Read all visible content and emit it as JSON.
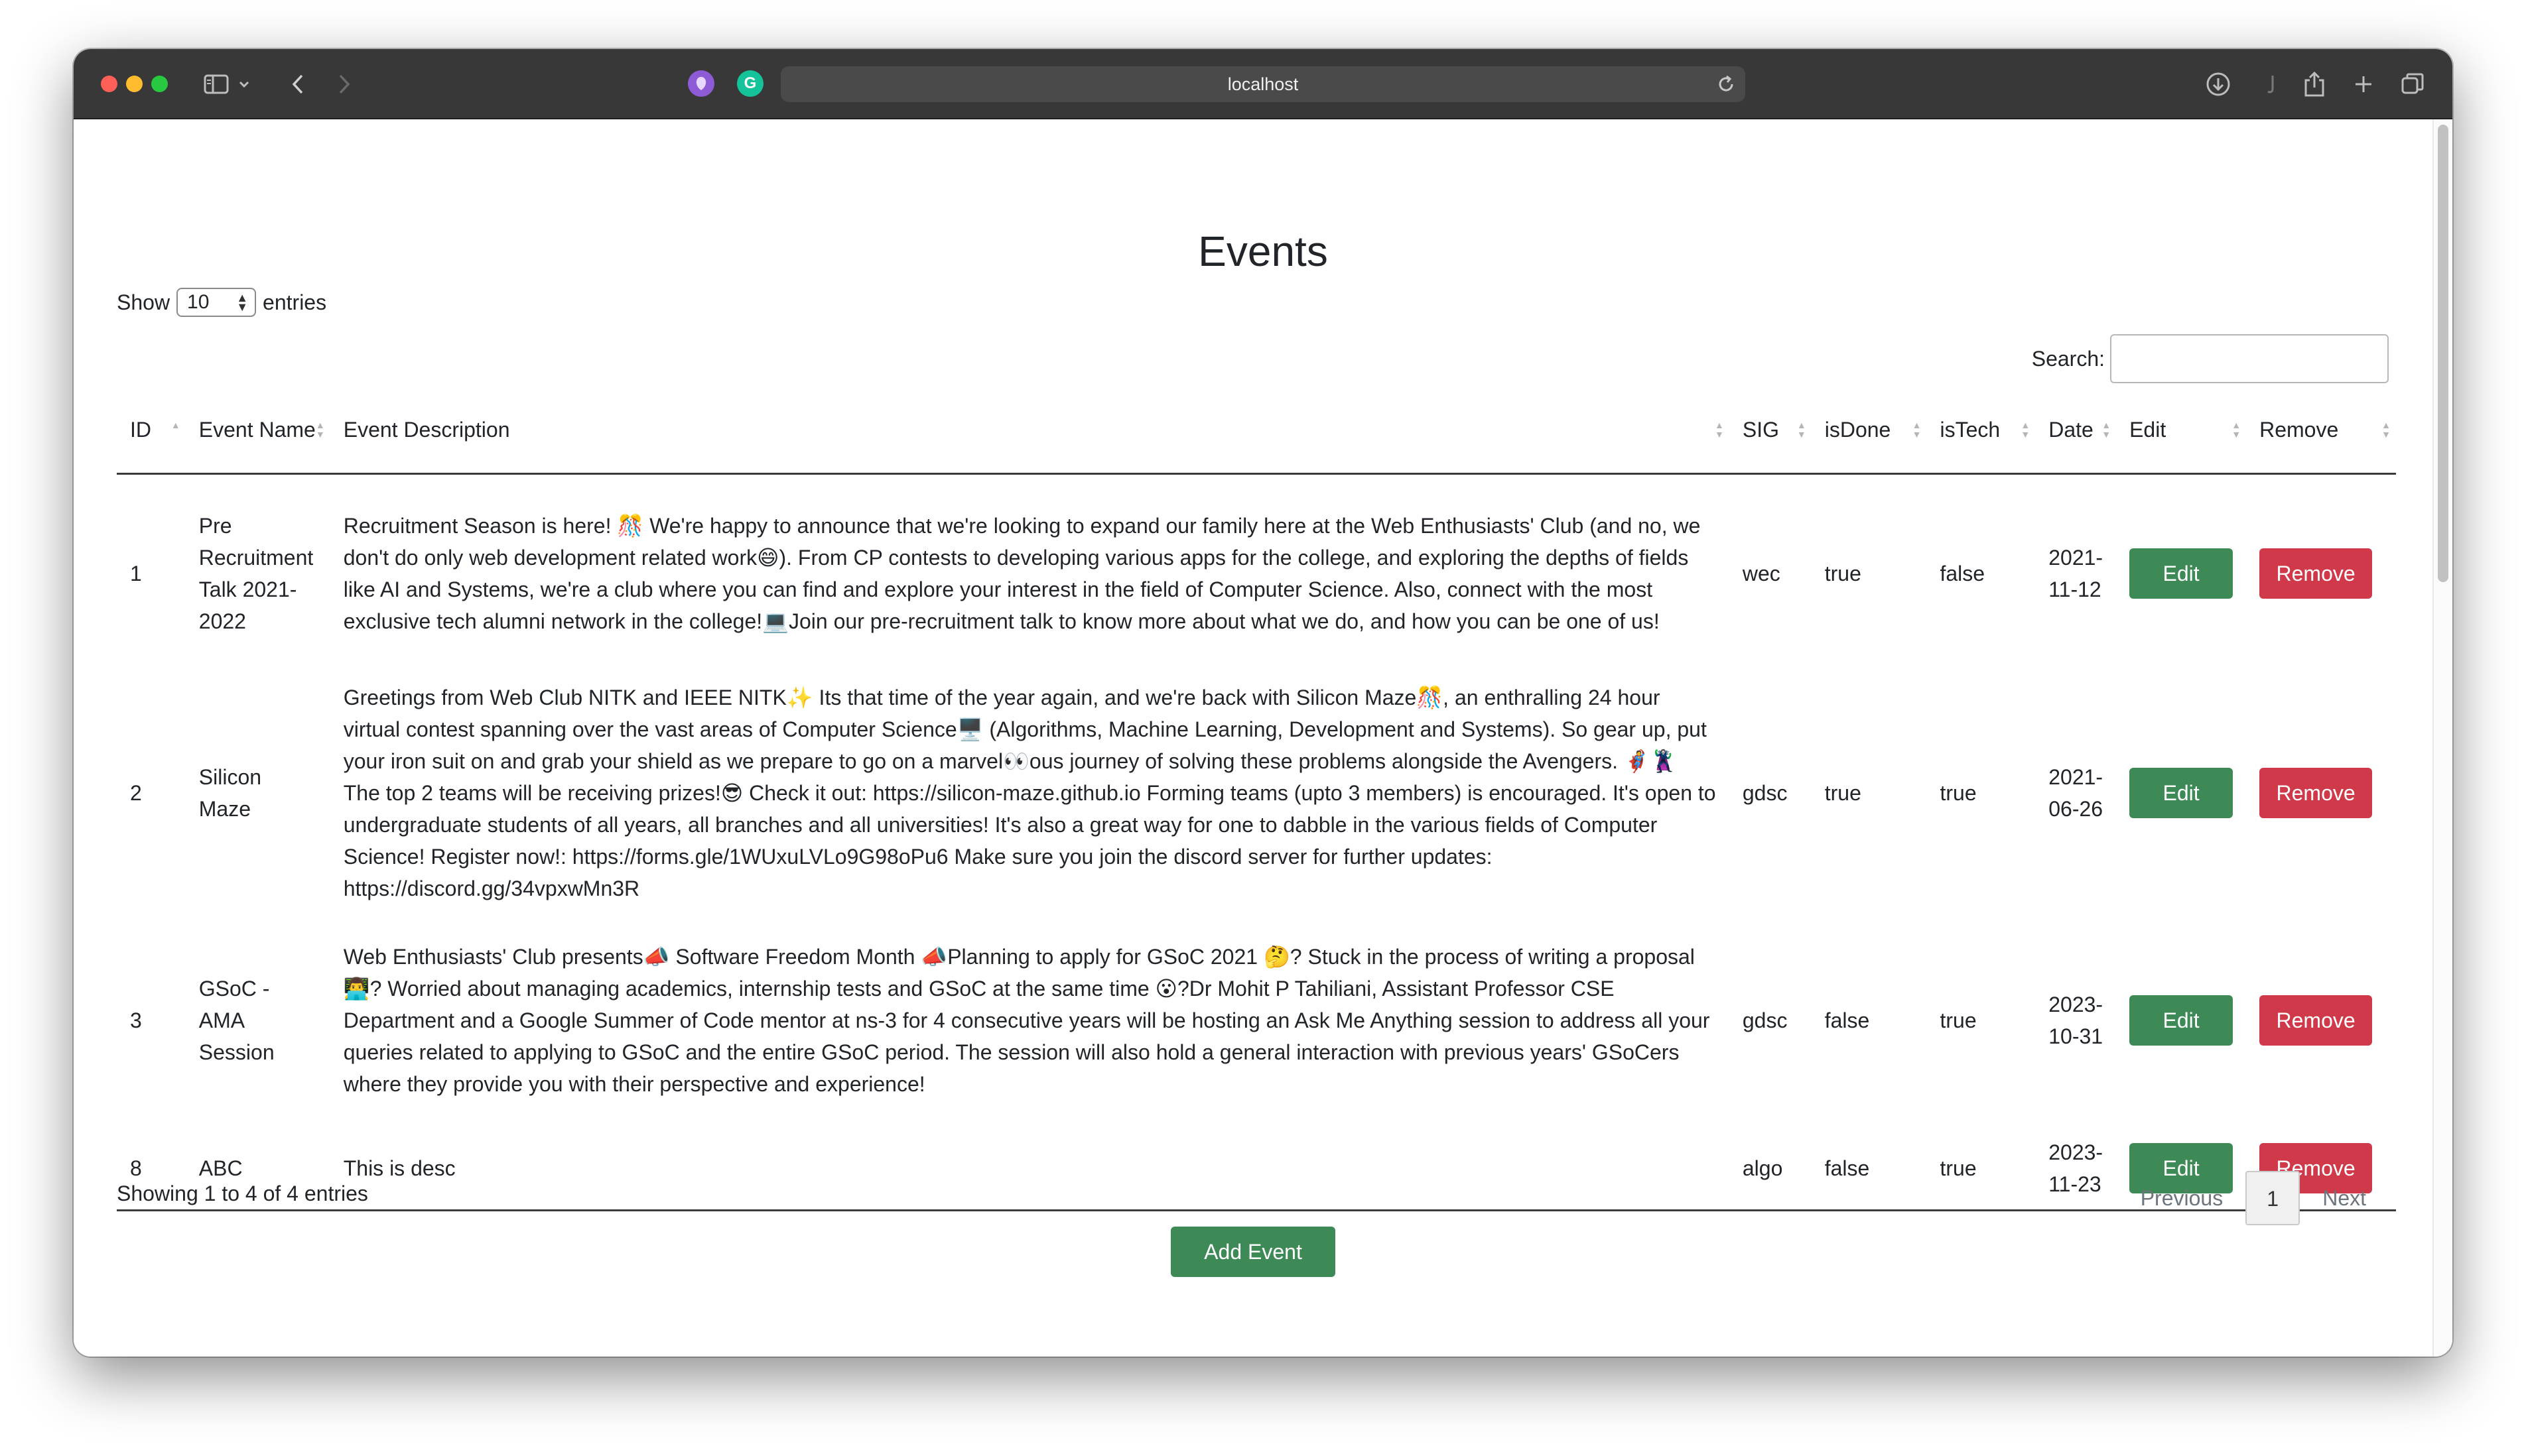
{
  "browser": {
    "url": "localhost",
    "icons": [
      "sidebar-icon",
      "chevron-down-icon",
      "back-icon",
      "forward-icon",
      "extension-icon",
      "grammarly-icon",
      "reload-icon",
      "download-icon",
      "share-icon",
      "new-tab-icon",
      "tabs-icon"
    ]
  },
  "page": {
    "title": "Events",
    "show_label": "Show",
    "entries_value": "10",
    "entries_label": "entries",
    "search_label": "Search:",
    "search_value": ""
  },
  "table": {
    "headers": [
      "ID",
      "Event Name",
      "Event Description",
      "SIG",
      "isDone",
      "isTech",
      "Date",
      "Edit",
      "Remove"
    ],
    "rows": [
      {
        "id": "1",
        "name": "Pre Recruitment Talk 2021-2022",
        "description": "Recruitment Season is here! 🎊 We're happy to announce that we're looking to expand our family here at the Web Enthusiasts' Club (and no, we don't do only web development related work😄). From CP contests to developing various apps for the college, and exploring the depths of fields like AI and Systems, we're a club where you can find and explore your interest in the field of Computer Science. Also, connect with the most exclusive tech alumni network in the college!💻Join our pre-recruitment talk to know more about what we do, and how you can be one of us!",
        "sig": "wec",
        "isDone": "true",
        "isTech": "false",
        "date": "2021-11-12"
      },
      {
        "id": "2",
        "name": "Silicon Maze",
        "description": "Greetings from Web Club NITK and IEEE NITK✨ Its that time of the year again, and we're back with Silicon Maze🎊, an enthralling 24 hour virtual contest spanning over the vast areas of Computer Science🖥️ (Algorithms, Machine Learning, Development and Systems). So gear up, put your iron suit on and grab your shield as we prepare to go on a marvel👀ous journey of solving these problems alongside the Avengers. 🦸🦹 The top 2 teams will be receiving prizes!😎 Check it out: https://silicon-maze.github.io Forming teams (upto 3 members) is encouraged. It's open to undergraduate students of all years, all branches and all universities! It's also a great way for one to dabble in the various fields of Computer Science! Register now!: https://forms.gle/1WUxuLVLo9G98oPu6 Make sure you join the discord server for further updates: https://discord.gg/34vpxwMn3R",
        "sig": "gdsc",
        "isDone": "true",
        "isTech": "true",
        "date": "2021-06-26"
      },
      {
        "id": "3",
        "name": "GSoC - AMA Session",
        "description": "Web Enthusiasts' Club presents📣 Software Freedom Month 📣Planning to apply for GSoC 2021 🤔? Stuck in the process of writing a proposal 👨‍💻? Worried about managing academics, internship tests and GSoC at the same time 😮?Dr Mohit P Tahiliani, Assistant Professor CSE Department and a Google Summer of Code mentor at ns-3 for 4 consecutive years will be hosting an Ask Me Anything session to address all your queries related to applying to GSoC and the entire GSoC period. The session will also hold a general interaction with previous years' GSoCers where they provide you with their perspective and experience!",
        "sig": "gdsc",
        "isDone": "false",
        "isTech": "true",
        "date": "2023-10-31"
      },
      {
        "id": "8",
        "name": "ABC",
        "description": "This is desc",
        "sig": "algo",
        "isDone": "false",
        "isTech": "true",
        "date": "2023-11-23"
      }
    ],
    "edit_label": "Edit",
    "remove_label": "Remove"
  },
  "footer": {
    "info": "Showing 1 to 4 of 4 entries",
    "previous": "Previous",
    "current_page": "1",
    "next": "Next",
    "add_event": "Add Event"
  },
  "colors": {
    "edit": "#3d8a57",
    "remove": "#d0394a",
    "titlebar": "#383838"
  }
}
